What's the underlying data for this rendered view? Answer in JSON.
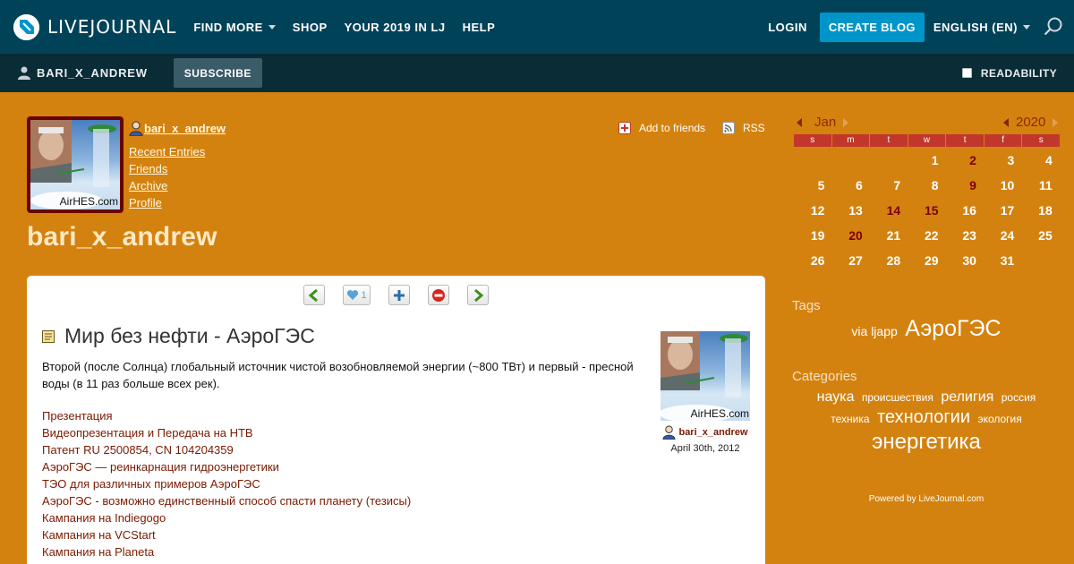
{
  "topnav": {
    "logo_text": "LIVEJOURNAL",
    "items": [
      {
        "label": "FIND MORE",
        "dropdown": true
      },
      {
        "label": "SHOP",
        "dropdown": false
      },
      {
        "label": "YOUR 2019 IN LJ",
        "dropdown": false
      },
      {
        "label": "HELP",
        "dropdown": false
      }
    ],
    "login": "LOGIN",
    "create_blog": "CREATE BLOG",
    "language": "ENGLISH (EN)"
  },
  "journal_bar": {
    "username": "BARI_X_ANDREW",
    "subscribe": "SUBSCRIBE",
    "readability": "READABILITY"
  },
  "header": {
    "username": "bari_x_andrew",
    "links": [
      "Recent Entries",
      "Friends",
      "Archive",
      "Profile"
    ],
    "journal_title": "bari_x_andrew",
    "add_to_friends": "Add to friends",
    "rss": "RSS",
    "userpic_caption": "AirHES.com"
  },
  "toolbar": {
    "like_count": "1"
  },
  "entry": {
    "title": "Мир без нефти - АэроГЭС",
    "body": "Второй (после Солнца) глобальный источник чистой возобновляемой энергии (~800 ТВт) и первый - пресной воды (в 11 раз больше всех рек).",
    "links": [
      "Презентация",
      "Видеопрезентация и Передача на НТВ",
      "Патент RU 2500854, CN 104204359",
      "АэроГЭС — реинкарнация гидроэнергетики",
      "ТЭО для различных примеров АэроГЭС",
      "АэроГЭС - возможно единственный способ спасти планету (тезисы)",
      "Кампания на Indiegogo",
      "Кампания на VCStart",
      "Кампания на Planeta"
    ],
    "author": "bari_x_andrew",
    "date": "April 30th, 2012",
    "userpic_caption": "AirHES.com"
  },
  "calendar": {
    "month": "Jan",
    "year": "2020",
    "weekdays": [
      "s",
      "m",
      "t",
      "w",
      "t",
      "f",
      "s"
    ],
    "weeks": [
      [
        "",
        "",
        "",
        "1",
        "2",
        "3",
        "4"
      ],
      [
        "5",
        "6",
        "7",
        "8",
        "9",
        "10",
        "11"
      ],
      [
        "12",
        "13",
        "14",
        "15",
        "16",
        "17",
        "18"
      ],
      [
        "19",
        "20",
        "21",
        "22",
        "23",
        "24",
        "25"
      ],
      [
        "26",
        "27",
        "28",
        "29",
        "30",
        "31",
        ""
      ]
    ],
    "highlighted": [
      "2",
      "9",
      "14",
      "15",
      "20"
    ]
  },
  "tags": {
    "title": "Tags",
    "items": [
      {
        "label": "via ljapp",
        "size": 14
      },
      {
        "label": "АэроГЭС",
        "size": 25
      }
    ]
  },
  "categories": {
    "title": "Categories",
    "items": [
      {
        "label": "наука",
        "size": 16
      },
      {
        "label": "происшествия",
        "size": 12
      },
      {
        "label": "религия",
        "size": 16
      },
      {
        "label": "россия",
        "size": 12
      },
      {
        "label": "техника",
        "size": 12
      },
      {
        "label": "технологии",
        "size": 20
      },
      {
        "label": "экология",
        "size": 12
      },
      {
        "label": "энергетика",
        "size": 24
      }
    ]
  },
  "footer": {
    "powered": "Powered by LiveJournal.com"
  },
  "colors": {
    "topbar": "#004359",
    "journal_bar": "#0a2c36",
    "create_button": "#0095c9",
    "page_background": "#d4820f",
    "link": "#7a1a00",
    "calendar_header": "#c2372b"
  }
}
